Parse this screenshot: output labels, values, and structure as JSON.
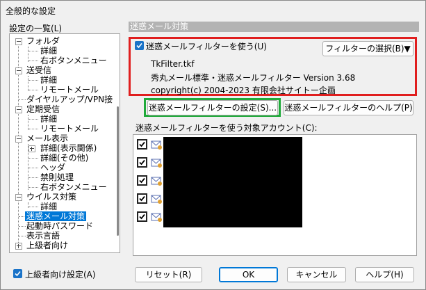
{
  "window": {
    "title": "全般的な設定"
  },
  "settings_list": {
    "label": "設定の一覧(L)",
    "items": [
      {
        "label": "フォルダ"
      },
      {
        "label": "詳細"
      },
      {
        "label": "右ボタンメニュー"
      },
      {
        "label": "送受信"
      },
      {
        "label": "詳細"
      },
      {
        "label": "リモートメール"
      },
      {
        "label": "ダイヤルアップ/VPN接続"
      },
      {
        "label": "定期受信"
      },
      {
        "label": "詳細"
      },
      {
        "label": "リモートメール"
      },
      {
        "label": "メール表示"
      },
      {
        "label": "詳細(表示関係)"
      },
      {
        "label": "詳細(その他)"
      },
      {
        "label": "ヘッダ"
      },
      {
        "label": "禁則処理"
      },
      {
        "label": "右ボタンメニュー"
      },
      {
        "label": "ウイルス対策"
      },
      {
        "label": "詳細"
      },
      {
        "label": "迷惑メール対策"
      },
      {
        "label": "起動時パスワード"
      },
      {
        "label": "表示言語"
      },
      {
        "label": "上級者向け"
      }
    ],
    "selected_index": 18
  },
  "advanced_settings_checkbox": {
    "label": "上級者向け設定(A)",
    "checked": true
  },
  "panel": {
    "header": "迷惑メール対策",
    "use_filter_checkbox": {
      "label": "迷惑メールフィルターを使う(U)",
      "checked": true
    },
    "select_filter_button": "フィルターの選択(B)▼",
    "filter_info": {
      "filename": "TkFilter.tkf",
      "name_version": "秀丸メール標準・迷惑メールフィルター Version 3.68",
      "copyright": "copyright(c) 2004-2023 有限会社サイトー企画"
    },
    "filter_settings_button": "迷惑メールフィルターの設定(S)...",
    "filter_help_button": "迷惑メールフィルターのヘルプ(P)",
    "accounts_label": "迷惑メールフィルターを使う対象アカウント(C):",
    "accounts": [
      {
        "checked": true,
        "icon": "account-icon"
      },
      {
        "checked": true,
        "icon": "account-icon"
      },
      {
        "checked": true,
        "icon": "account-icon"
      },
      {
        "checked": true,
        "icon": "account-icon"
      },
      {
        "checked": true,
        "icon": "account-icon"
      }
    ]
  },
  "footer": {
    "reset": "リセット(R)",
    "ok": "OK",
    "cancel": "キャンセル",
    "help": "ヘルプ(H)"
  },
  "colors": {
    "accent": "#0078d7",
    "highlight_red": "#e01e1e",
    "highlight_green": "#1faa3a",
    "section_header": "#b3b3b3"
  }
}
